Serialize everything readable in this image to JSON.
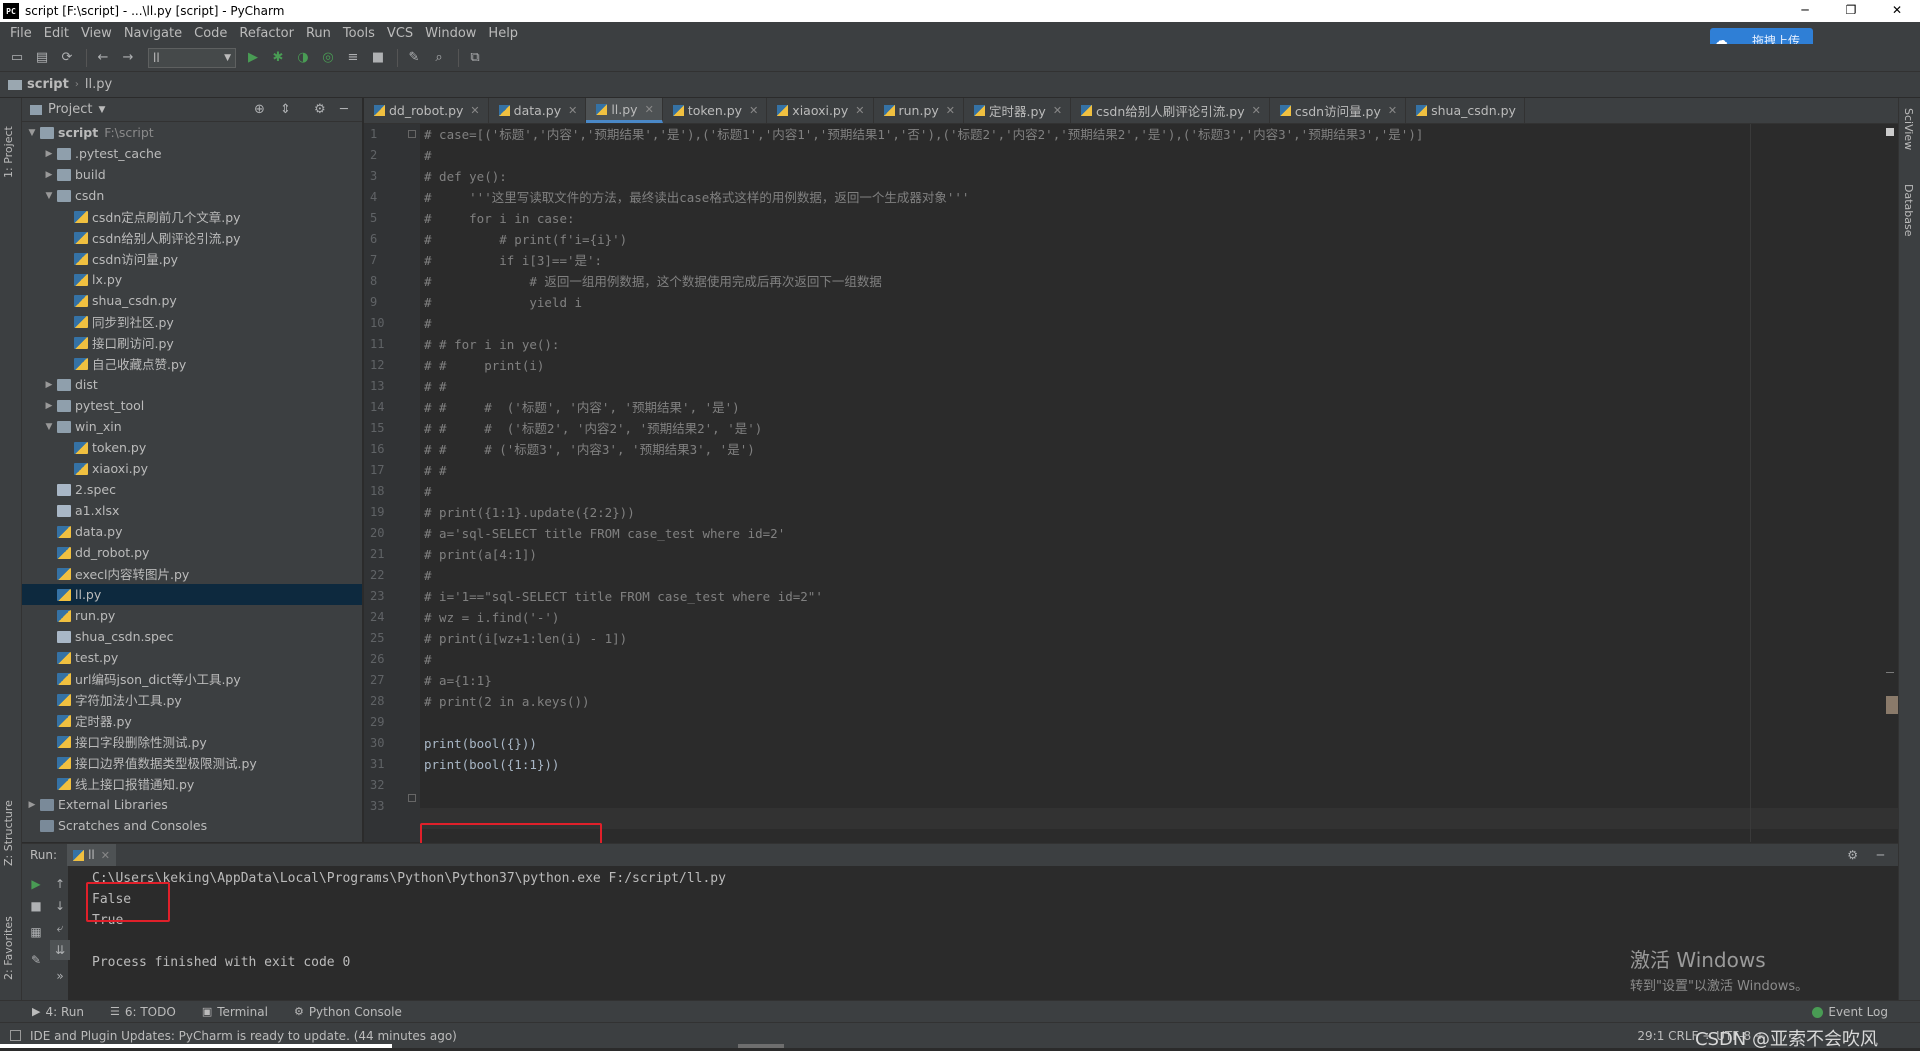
{
  "window": {
    "title": "script [F:\\script] - ...\\ll.py [script] - PyCharm",
    "app_icon": "PC",
    "minimize": "─",
    "maximize": "❐",
    "close": "✕"
  },
  "menu": [
    "File",
    "Edit",
    "View",
    "Navigate",
    "Code",
    "Refactor",
    "Run",
    "Tools",
    "VCS",
    "Window",
    "Help"
  ],
  "upload_badge": {
    "text": "拖拽上传"
  },
  "toolbar": {
    "run_config": "ll"
  },
  "navbar": {
    "project": "script",
    "file": "ll.py"
  },
  "left_strip": {
    "project": "1: Project",
    "structure": "Z: Structure",
    "favorites": "2: Favorites"
  },
  "right_strip": {
    "sciview": "SciView",
    "database": "Database"
  },
  "project_panel": {
    "title": "Project",
    "items": [
      {
        "label": "script",
        "extra": "F:\\script",
        "indent": 0,
        "arrow": "▼",
        "icon": "folder",
        "bold": true
      },
      {
        "label": ".pytest_cache",
        "indent": 1,
        "arrow": "▶",
        "icon": "folder"
      },
      {
        "label": "build",
        "indent": 1,
        "arrow": "▶",
        "icon": "folder"
      },
      {
        "label": "csdn",
        "indent": 1,
        "arrow": "▼",
        "icon": "folder"
      },
      {
        "label": "csdn定点刷前几个文章.py",
        "indent": 2,
        "icon": "py"
      },
      {
        "label": "csdn给别人刷评论引流.py",
        "indent": 2,
        "icon": "py"
      },
      {
        "label": "csdn访问量.py",
        "indent": 2,
        "icon": "py"
      },
      {
        "label": "lx.py",
        "indent": 2,
        "icon": "py"
      },
      {
        "label": "shua_csdn.py",
        "indent": 2,
        "icon": "py"
      },
      {
        "label": "同步到社区.py",
        "indent": 2,
        "icon": "py"
      },
      {
        "label": "接口刷访问.py",
        "indent": 2,
        "icon": "py"
      },
      {
        "label": "自己收藏点赞.py",
        "indent": 2,
        "icon": "py"
      },
      {
        "label": "dist",
        "indent": 1,
        "arrow": "▶",
        "icon": "folder"
      },
      {
        "label": "pytest_tool",
        "indent": 1,
        "arrow": "▶",
        "icon": "folder"
      },
      {
        "label": "win_xin",
        "indent": 1,
        "arrow": "▼",
        "icon": "folder"
      },
      {
        "label": "token.py",
        "indent": 2,
        "icon": "py"
      },
      {
        "label": "xiaoxi.py",
        "indent": 2,
        "icon": "py"
      },
      {
        "label": "2.spec",
        "indent": 1,
        "icon": "file"
      },
      {
        "label": "a1.xlsx",
        "indent": 1,
        "icon": "file"
      },
      {
        "label": "data.py",
        "indent": 1,
        "icon": "py"
      },
      {
        "label": "dd_robot.py",
        "indent": 1,
        "icon": "py"
      },
      {
        "label": "execl内容转图片.py",
        "indent": 1,
        "icon": "py"
      },
      {
        "label": "ll.py",
        "indent": 1,
        "icon": "py",
        "selected": true
      },
      {
        "label": "run.py",
        "indent": 1,
        "icon": "py"
      },
      {
        "label": "shua_csdn.spec",
        "indent": 1,
        "icon": "file"
      },
      {
        "label": "test.py",
        "indent": 1,
        "icon": "py"
      },
      {
        "label": "url编码json_dict等小工具.py",
        "indent": 1,
        "icon": "py"
      },
      {
        "label": "字符加法小工具.py",
        "indent": 1,
        "icon": "py"
      },
      {
        "label": "定时器.py",
        "indent": 1,
        "icon": "py"
      },
      {
        "label": "接口字段删除性测试.py",
        "indent": 1,
        "icon": "py"
      },
      {
        "label": "接口边界值数据类型极限测试.py",
        "indent": 1,
        "icon": "py"
      },
      {
        "label": "线上接口报错通知.py",
        "indent": 1,
        "icon": "py"
      },
      {
        "label": "External Libraries",
        "indent": 0,
        "arrow": "▶",
        "icon": "lib"
      },
      {
        "label": "Scratches and Consoles",
        "indent": 0,
        "icon": "lib"
      }
    ]
  },
  "tabs": [
    {
      "label": "dd_robot.py"
    },
    {
      "label": "data.py"
    },
    {
      "label": "ll.py",
      "active": true
    },
    {
      "label": "token.py"
    },
    {
      "label": "xiaoxi.py"
    },
    {
      "label": "run.py"
    },
    {
      "label": "定时器.py"
    },
    {
      "label": "csdn给别人刷评论引流.py"
    },
    {
      "label": "csdn访问量.py"
    },
    {
      "label": "shua_csdn.py",
      "no_close": true
    }
  ],
  "code_lines": [
    "# case=[('标题','内容','预期结果','是'),('标题1','内容1','预期结果1','否'),('标题2','内容2','预期结果2','是'),('标题3','内容3','预期结果3','是')]",
    "#",
    "# def ye():",
    "#     '''这里写读取文件的方法，最终读出case格式这样的用例数据，返回一个生成器对象'''",
    "#     for i in case:",
    "#         # print(f'i={i}')",
    "#         if i[3]=='是':",
    "#             # 返回一组用例数据，这个数据使用完成后再次返回下一组数据",
    "#             yield i",
    "#",
    "# # for i in ye():",
    "# #     print(i)",
    "# #",
    "# #     #  ('标题', '内容', '预期结果', '是')",
    "# #     #  ('标题2', '内容2', '预期结果2', '是')",
    "# #     # ('标题3', '内容3', '预期结果3', '是')",
    "# #",
    "#",
    "# print({1:1}.update({2:2}))",
    "# a='sql-SELECT title FROM case_test where id=2'",
    "# print(a[4:1])",
    "#",
    "# i='1==\"sql-SELECT title FROM case_test where id=2\"'",
    "# wz = i.find('-')",
    "# print(i[wz+1:len(i) - 1])",
    "#",
    "# a={1:1}",
    "# print(2 in a.keys())",
    "",
    "print(bool({}))",
    "print(bool({1:1}))",
    "",
    ""
  ],
  "run": {
    "label": "Run:",
    "tab": "ll",
    "console": [
      "C:\\Users\\keking\\AppData\\Local\\Programs\\Python\\Python37\\python.exe F:/script/ll.py",
      "False",
      "True",
      "",
      "Process finished with exit code 0"
    ]
  },
  "activate_windows": {
    "line1": "激活 Windows",
    "line2": "转到\"设置\"以激活 Windows。"
  },
  "bottom_tools": [
    {
      "label": "4: Run",
      "icon": "▶"
    },
    {
      "label": "6: TODO",
      "icon": "☰"
    },
    {
      "label": "Terminal",
      "icon": "▣"
    },
    {
      "label": "Python Console",
      "icon": "⚙"
    }
  ],
  "event_log": "Event Log",
  "status": {
    "message": "IDE and Plugin Updates: PyCharm is ready to update. (44 minutes ago)",
    "position": "29:1  CRLF ÷  UTF-8 ÷",
    "watermark": "CSDN @亚索不会吹风"
  }
}
